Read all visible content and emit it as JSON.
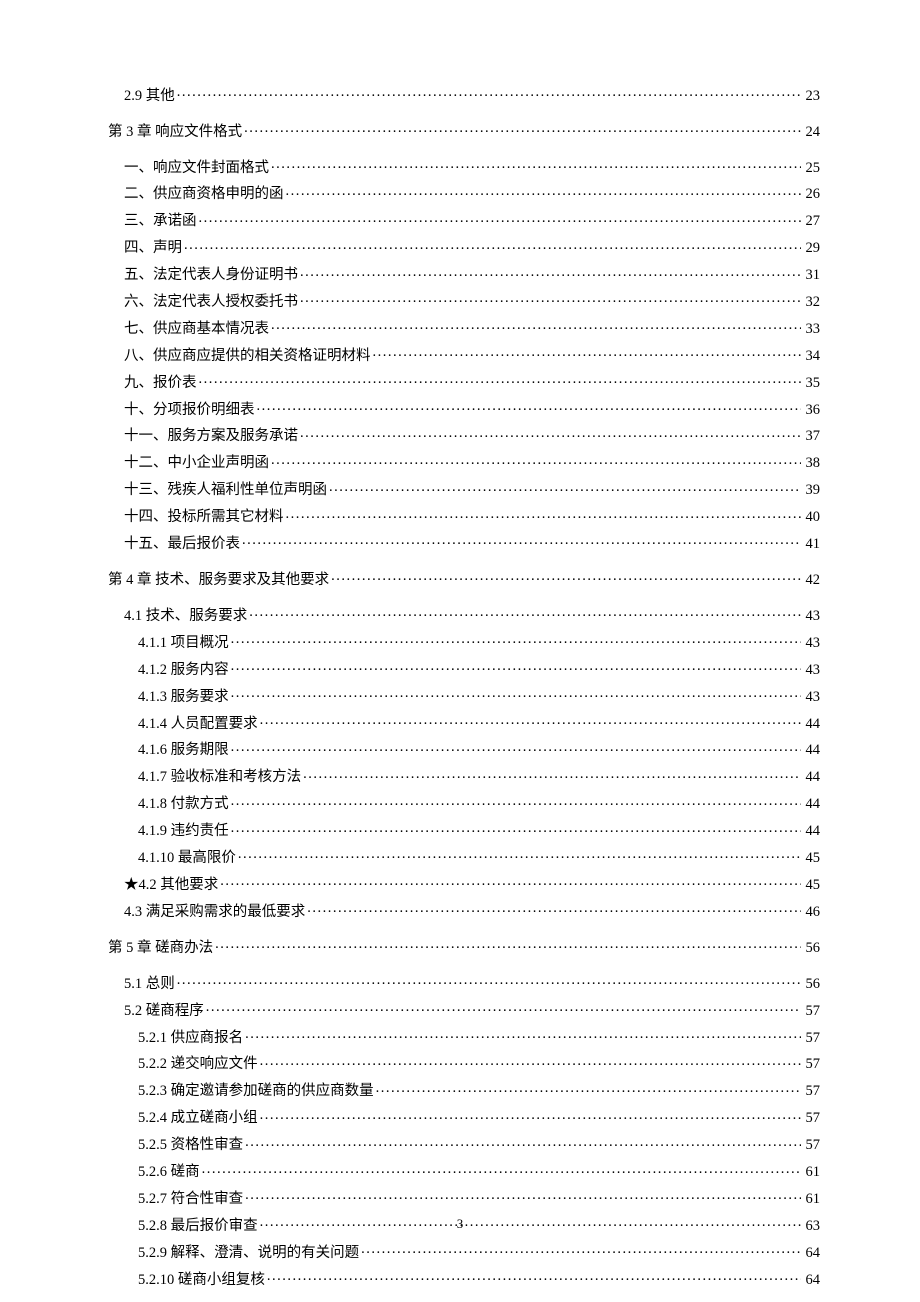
{
  "toc": [
    {
      "level": 1,
      "label": "2.9 其他",
      "page": "23",
      "chapter": false
    },
    {
      "level": 0,
      "label": "第 3 章  响应文件格式",
      "page": "24",
      "chapter": true
    },
    {
      "level": 1,
      "label": "一、响应文件封面格式 ",
      "page": "25",
      "chapter": false
    },
    {
      "level": 1,
      "label": "二、供应商资格申明的函 ",
      "page": "26",
      "chapter": false
    },
    {
      "level": 1,
      "label": "三、承诺函 ",
      "page": "27",
      "chapter": false
    },
    {
      "level": 1,
      "label": "四、声明 ",
      "page": "29",
      "chapter": false
    },
    {
      "level": 1,
      "label": "五、法定代表人身份证明书 ",
      "page": "31",
      "chapter": false
    },
    {
      "level": 1,
      "label": "六、法定代表人授权委托书 ",
      "page": "32",
      "chapter": false
    },
    {
      "level": 1,
      "label": "七、供应商基本情况表 ",
      "page": "33",
      "chapter": false
    },
    {
      "level": 1,
      "label": "八、供应商应提供的相关资格证明材料 ",
      "page": "34",
      "chapter": false
    },
    {
      "level": 1,
      "label": "九、报价表 ",
      "page": "35",
      "chapter": false
    },
    {
      "level": 1,
      "label": "十、分项报价明细表 ",
      "page": "36",
      "chapter": false
    },
    {
      "level": 1,
      "label": "十一、服务方案及服务承诺 ",
      "page": "37",
      "chapter": false
    },
    {
      "level": 1,
      "label": "十二、中小企业声明函 ",
      "page": "38",
      "chapter": false
    },
    {
      "level": 1,
      "label": "十三、残疾人福利性单位声明函 ",
      "page": "39",
      "chapter": false
    },
    {
      "level": 1,
      "label": "十四、投标所需其它材料 ",
      "page": "40",
      "chapter": false
    },
    {
      "level": 1,
      "label": "十五、最后报价表 ",
      "page": "41",
      "chapter": false
    },
    {
      "level": 0,
      "label": "第 4 章 技术、服务要求及其他要求",
      "page": "42",
      "chapter": true
    },
    {
      "level": 1,
      "label": "4.1 技术、服务要求",
      "page": "43",
      "chapter": false
    },
    {
      "level": 2,
      "label": "4.1.1 项目概况",
      "page": "43",
      "chapter": false
    },
    {
      "level": 2,
      "label": "4.1.2 服务内容",
      "page": "43",
      "chapter": false
    },
    {
      "level": 2,
      "label": "4.1.3 服务要求",
      "page": "43",
      "chapter": false
    },
    {
      "level": 2,
      "label": "4.1.4 人员配置要求",
      "page": "44",
      "chapter": false
    },
    {
      "level": 2,
      "label": "4.1.6 服务期限",
      "page": "44",
      "chapter": false
    },
    {
      "level": 2,
      "label": "4.1.7 验收标准和考核方法",
      "page": "44",
      "chapter": false
    },
    {
      "level": 2,
      "label": "4.1.8 付款方式",
      "page": "44",
      "chapter": false
    },
    {
      "level": 2,
      "label": "4.1.9 违约责任",
      "page": "44",
      "chapter": false
    },
    {
      "level": 2,
      "label": "4.1.10 最高限价",
      "page": "45",
      "chapter": false
    },
    {
      "level": 1,
      "label": "★4.2 其他要求",
      "page": "45",
      "chapter": false
    },
    {
      "level": 1,
      "label": "4.3 满足采购需求的最低要求",
      "page": "46",
      "chapter": false
    },
    {
      "level": 0,
      "label": "第 5 章 磋商办法",
      "page": "56",
      "chapter": true
    },
    {
      "level": 1,
      "label": "5.1 总则",
      "page": "56",
      "chapter": false
    },
    {
      "level": 1,
      "label": "5.2 磋商程序",
      "page": "57",
      "chapter": false
    },
    {
      "level": 2,
      "label": "5.2.1 供应商报名",
      "page": "57",
      "chapter": false
    },
    {
      "level": 2,
      "label": "5.2.2 递交响应文件",
      "page": "57",
      "chapter": false
    },
    {
      "level": 2,
      "label": "5.2.3 确定邀请参加磋商的供应商数量",
      "page": "57",
      "chapter": false
    },
    {
      "level": 2,
      "label": "5.2.4 成立磋商小组",
      "page": "57",
      "chapter": false
    },
    {
      "level": 2,
      "label": "5.2.5 资格性审查",
      "page": "57",
      "chapter": false
    },
    {
      "level": 2,
      "label": "5.2.6 磋商",
      "page": "61",
      "chapter": false
    },
    {
      "level": 2,
      "label": "5.2.7 符合性审查",
      "page": "61",
      "chapter": false
    },
    {
      "level": 2,
      "label": "5.2.8 最后报价审查",
      "page": "63",
      "chapter": false
    },
    {
      "level": 2,
      "label": "5.2.9 解释、澄清、说明的有关问题",
      "page": "64",
      "chapter": false
    },
    {
      "level": 2,
      "label": "5.2.10 磋商小组复核",
      "page": "64",
      "chapter": false
    }
  ],
  "footer_page": "3"
}
